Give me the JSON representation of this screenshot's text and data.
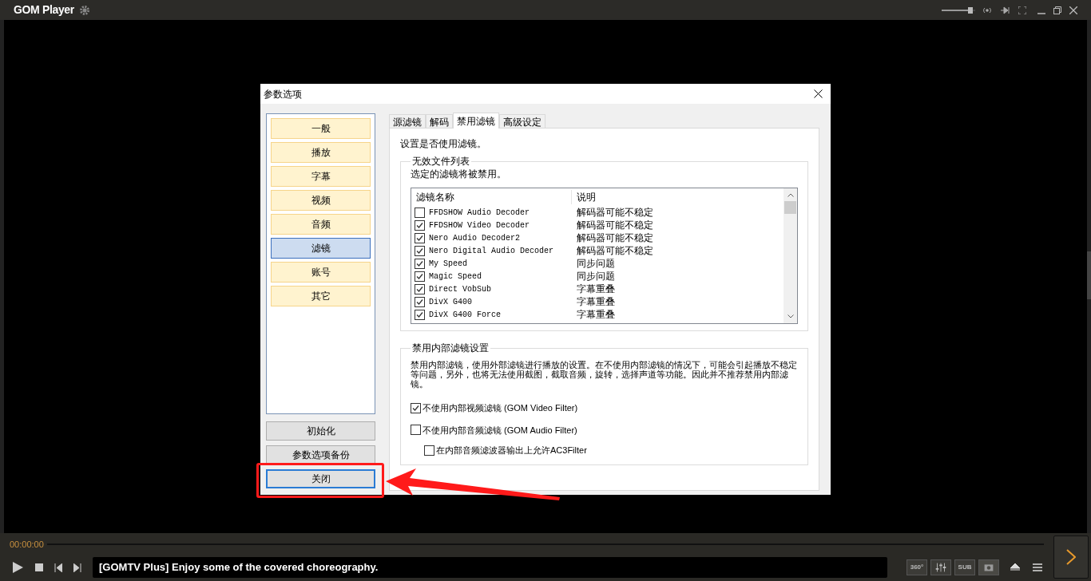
{
  "player": {
    "title": "GOM Player",
    "time": "00:00:00",
    "ticker": "[GOMTV Plus] Enjoy some of the covered choreography.",
    "vr_label": "360°",
    "sub_label": "SUB",
    "volume": {
      "level": 0.85
    }
  },
  "dialog": {
    "title": "参数选项",
    "nav_items": [
      {
        "label": "一般",
        "selected": false
      },
      {
        "label": "播放",
        "selected": false
      },
      {
        "label": "字幕",
        "selected": false
      },
      {
        "label": "视频",
        "selected": false
      },
      {
        "label": "音频",
        "selected": false
      },
      {
        "label": "滤镜",
        "selected": true
      },
      {
        "label": "账号",
        "selected": false
      },
      {
        "label": "其它",
        "selected": false
      }
    ],
    "buttons": [
      {
        "label": "初始化",
        "focused": false
      },
      {
        "label": "参数选项备份",
        "focused": false
      },
      {
        "label": "关闭",
        "focused": true
      }
    ],
    "tabs": [
      {
        "label": "源滤镜",
        "selected": false
      },
      {
        "label": "解码",
        "selected": false
      },
      {
        "label": "禁用滤镜",
        "selected": true
      },
      {
        "label": "高级设定",
        "selected": false
      }
    ],
    "description": "设置是否使用滤镜。",
    "file_list": {
      "title": "无效文件列表",
      "hint": "选定的滤镜将被禁用。",
      "columns": [
        "滤镜名称",
        "说明"
      ],
      "rows": [
        {
          "name": "FFDSHOW Audio Decoder",
          "note": "解码器可能不稳定",
          "checked": false
        },
        {
          "name": "FFDSHOW Video Decoder",
          "note": "解码器可能不稳定",
          "checked": true
        },
        {
          "name": "Nero Audio Decoder2",
          "note": "解码器可能不稳定",
          "checked": true
        },
        {
          "name": "Nero Digital Audio Decoder",
          "note": "解码器可能不稳定",
          "checked": true
        },
        {
          "name": "My Speed",
          "note": "同步问题",
          "checked": true
        },
        {
          "name": "Magic Speed",
          "note": "同步问题",
          "checked": true
        },
        {
          "name": "Direct VobSub",
          "note": "字幕重叠",
          "checked": true
        },
        {
          "name": "DivX G400",
          "note": "字幕重叠",
          "checked": true
        },
        {
          "name": "DivX G400 Force",
          "note": "字幕重叠",
          "checked": true
        }
      ]
    },
    "internal": {
      "title": "禁用内部滤镜设置",
      "text": "禁用内部滤镜，使用外部滤镜进行播放的设置。在不使用内部滤镜的情况下，可能会引起播放不稳定等问题，另外，也将无法使用截图，截取音频，旋转，选择声道等功能。因此并不推荐禁用内部滤镜。",
      "options": [
        {
          "label": "不使用内部视频滤镜 (GOM Video Filter)",
          "checked": true
        },
        {
          "label": "不使用内部音频滤镜 (GOM Audio Filter)",
          "checked": false,
          "children": [
            {
              "label": "在内部音频滤波器输出上允许AC3Filter",
              "checked": false
            }
          ]
        }
      ]
    }
  }
}
